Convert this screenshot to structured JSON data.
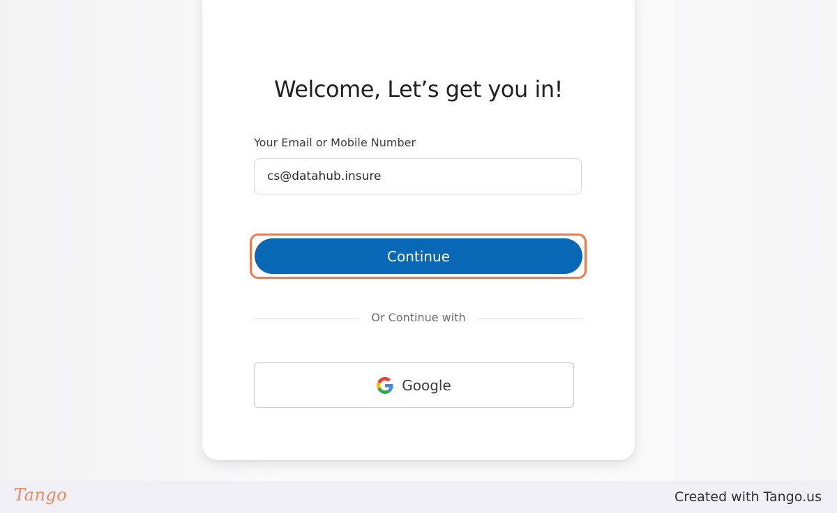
{
  "login": {
    "title": "Welcome, Let’s get you in!",
    "email_label": "Your Email or Mobile Number",
    "email_value": "cs@datahub.insure",
    "continue_label": "Continue",
    "divider_text": "Or Continue with",
    "google_label": "Google",
    "google_icon": "google-g-icon"
  },
  "footer": {
    "logo_text": "Tango",
    "created_with": "Created with Tango.us"
  },
  "colors": {
    "primary_button": "#0868b5",
    "highlight": "#ee7a4c",
    "logo": "#f08a5d"
  }
}
